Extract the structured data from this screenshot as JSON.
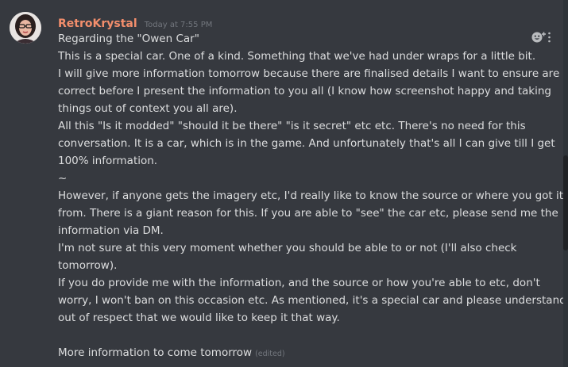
{
  "message": {
    "author": "RetroKrystal",
    "author_color": "#f38e6c",
    "timestamp": "Today at 7:55 PM",
    "avatar_icon": "user-avatar",
    "reaction_icon": "add-reaction-icon",
    "lines": [
      "Regarding the \"Owen Car\"",
      "This is a special car. One of a kind. Something that we've had under wraps for a little bit.",
      "I will give more information tomorrow because there are finalised details I want to ensure are",
      "correct before I present the information to you all (I know how screenshot happy and taking",
      "things out of context you all are).",
      "All this \"Is it modded\" \"should it be there\" \"is it secret\" etc etc. There's no need for this",
      "conversation. It is a car, which is in the game. And unfortunately that's all I can give till I get",
      "100% information.",
      "~",
      "However, if anyone gets the imagery etc, I'd really like to know the source or where you got it",
      "from. There is a giant reason for this. If you are able to \"see\" the car etc, please send me the",
      "information via DM.",
      "I'm not sure at this very moment whether you should be able to or not (I'll also check",
      "tomorrow).",
      "If you do provide me with the information, and the source or how you're able to etc, don't",
      "worry, I won't ban on this occasion etc. As mentioned, it's a special car and please understand",
      "out of respect that we would like to keep it that way.",
      "",
      "More information to come tomorrow"
    ],
    "edited_label": "(edited)"
  }
}
